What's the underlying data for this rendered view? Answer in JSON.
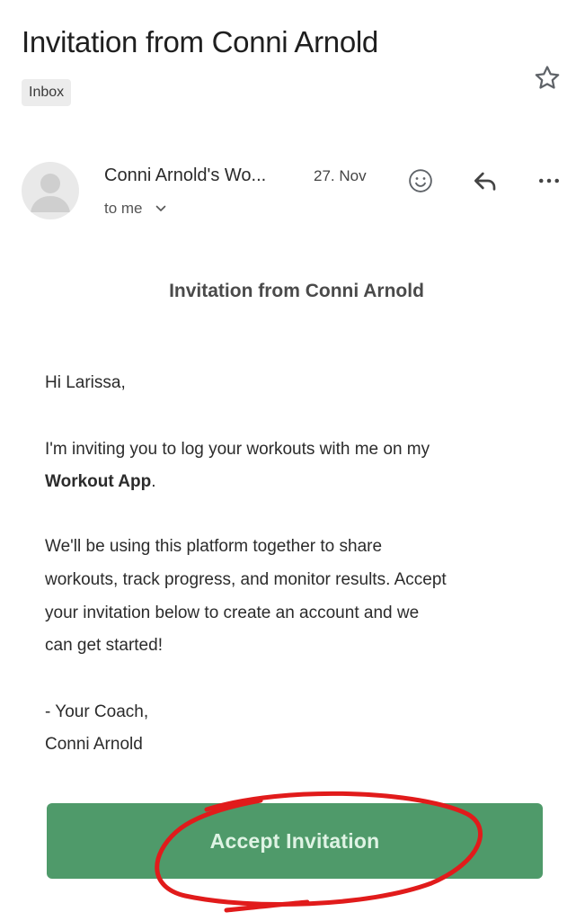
{
  "header": {
    "subject": "Invitation from Conni Arnold",
    "label": "Inbox",
    "star_icon": "star-outline-icon"
  },
  "message_meta": {
    "sender": "Conni Arnold's Wo...",
    "date": "27. Nov",
    "recipient": "to me",
    "recipient_toggle_icon": "chevron-down-icon",
    "actions": [
      "smiley-icon",
      "reply-icon",
      "more-options-icon"
    ]
  },
  "email": {
    "title": "Invitation from Conni Arnold",
    "greeting": "Hi Larissa,",
    "p1_line1": "I'm inviting you to log your workouts with me on my",
    "p1_bold": "Workout App",
    "p1_end": ".",
    "p2_line1": "We'll be using this platform together to share",
    "p2_line2": "workouts, track progress, and monitor results. Accept",
    "p2_line3": "your invitation below to create an account and we",
    "p2_line4": "can get started!",
    "signoff_line1": "- Your Coach,",
    "signoff_line2": "Conni Arnold",
    "cta_label": "Accept Invitation"
  },
  "colors": {
    "cta_background": "#4f9a6a",
    "cta_text": "#dff3e4",
    "annotation": "#e11b1b"
  }
}
